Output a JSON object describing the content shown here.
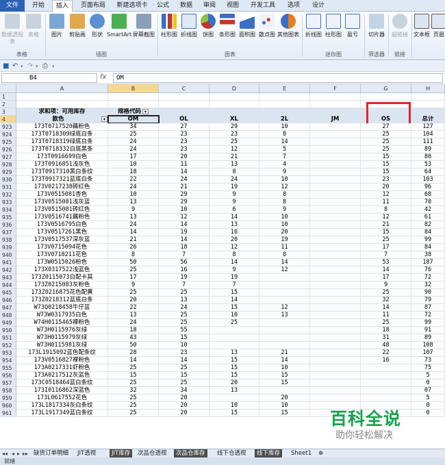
{
  "ribbon": {
    "tabs": [
      "文件",
      "开始",
      "插入",
      "页面布局",
      "新建选项卡",
      "公式",
      "数据",
      "审阅",
      "视图",
      "开发工具",
      "选项",
      "设计"
    ],
    "active_tab": "插入",
    "buttons": [
      "数据透视表",
      "表格",
      "图片",
      "剪贴画",
      "形状",
      "SmartArt",
      "屏幕截图",
      "柱形图",
      "折线图",
      "饼图",
      "条形图",
      "面积图",
      "散点图",
      "其他图表",
      "折线图",
      "柱形图",
      "盈亏",
      "切片器",
      "超链接",
      "文本框",
      "页眉"
    ],
    "groups": [
      "表格",
      "插图",
      "图表",
      "迷你图",
      "筛选器",
      "链接"
    ]
  },
  "formula_bar": {
    "name_box": "B4",
    "fx": "fx",
    "content": "OM"
  },
  "columns": [
    "A",
    "B",
    "C",
    "D",
    "E",
    "F",
    "G",
    "H"
  ],
  "header_rows": {
    "r1": "1",
    "r2": "2",
    "r3": "3",
    "r4": "4",
    "pivot_title": "求和项：可用库存",
    "size_code": "规格代码",
    "style_color": "款色",
    "sizes": [
      "OM",
      "OL",
      "XL",
      "2L",
      "JM",
      "OS",
      "总计"
    ]
  },
  "rows": [
    {
      "n": "923",
      "name": "173T0717520藕粉色",
      "v": [
        "34",
        "27",
        "29",
        "10",
        "",
        "27",
        "127"
      ]
    },
    {
      "n": "924",
      "name": "173T0718309绿底白条",
      "v": [
        "25",
        "23",
        "23",
        "8",
        "",
        "25",
        "104"
      ]
    },
    {
      "n": "925",
      "name": "173T0718319绿底白条",
      "v": [
        "24",
        "23",
        "25",
        "14",
        "",
        "25",
        "111"
      ]
    },
    {
      "n": "926",
      "name": "173T0718332白底黑条",
      "v": [
        "24",
        "23",
        "12",
        "5",
        "",
        "25",
        "89"
      ]
    },
    {
      "n": "927",
      "name": "173T0916699白色",
      "v": [
        "17",
        "20",
        "21",
        "7",
        "",
        "15",
        "80"
      ]
    },
    {
      "n": "928",
      "name": "173T0916851浅灰色",
      "v": [
        "10",
        "11",
        "13",
        "4",
        "",
        "15",
        "53"
      ]
    },
    {
      "n": "929",
      "name": "173T0917310黑白条纹",
      "v": [
        "18",
        "14",
        "8",
        "9",
        "",
        "15",
        "64"
      ]
    },
    {
      "n": "930",
      "name": "173T0917321蓝底白条",
      "v": [
        "22",
        "24",
        "24",
        "10",
        "",
        "23",
        "103"
      ]
    },
    {
      "n": "931",
      "name": "173V0217238砖红色",
      "v": [
        "24",
        "21",
        "19",
        "12",
        "",
        "20",
        "96"
      ]
    },
    {
      "n": "932",
      "name": "173V0515081杏色",
      "v": [
        "10",
        "29",
        "9",
        "8",
        "",
        "12",
        "68"
      ]
    },
    {
      "n": "933",
      "name": "173V0515081浅灰蓝",
      "v": [
        "13",
        "29",
        "9",
        "8",
        "",
        "11",
        "70"
      ]
    },
    {
      "n": "934",
      "name": "173V0515081砖红色",
      "v": [
        "9",
        "10",
        "6",
        "9",
        "",
        "8",
        "42"
      ]
    },
    {
      "n": "935",
      "name": "173V0516741藕粉色",
      "v": [
        "13",
        "12",
        "14",
        "10",
        "",
        "12",
        "61"
      ]
    },
    {
      "n": "936",
      "name": "173V0516795白色",
      "v": [
        "24",
        "14",
        "13",
        "10",
        "",
        "21",
        "82"
      ]
    },
    {
      "n": "937",
      "name": "173V0517261黑色",
      "v": [
        "14",
        "19",
        "16",
        "20",
        "",
        "15",
        "84"
      ]
    },
    {
      "n": "938",
      "name": "173V0517537深灰蓝",
      "v": [
        "21",
        "14",
        "20",
        "19",
        "",
        "25",
        "99"
      ]
    },
    {
      "n": "939",
      "name": "173V0715094花色",
      "v": [
        "26",
        "18",
        "12",
        "11",
        "",
        "17",
        "84"
      ]
    },
    {
      "n": "940",
      "name": "173V0718211花色",
      "v": [
        "8",
        "7",
        "8",
        "8",
        "",
        "7",
        "38"
      ]
    },
    {
      "n": "941",
      "name": "173W0515026粉色",
      "v": [
        "50",
        "56",
        "14",
        "14",
        "",
        "53",
        "187"
      ]
    },
    {
      "n": "942",
      "name": "173X0317522浅蓝色",
      "v": [
        "25",
        "16",
        "9",
        "12",
        "",
        "14",
        "76"
      ]
    },
    {
      "n": "943",
      "name": "173Z0115073白配卡其",
      "v": [
        "17",
        "19",
        "19",
        "",
        "",
        "17",
        "72"
      ]
    },
    {
      "n": "944",
      "name": "173Z0215083灰粉色",
      "v": [
        "9",
        "7",
        "7",
        "",
        "",
        "9",
        "32"
      ]
    },
    {
      "n": "945",
      "name": "173Z0216875花色配黄",
      "v": [
        "25",
        "25",
        "15",
        "",
        "",
        "25",
        "90"
      ]
    },
    {
      "n": "946",
      "name": "173Z0218312蓝底白条",
      "v": [
        "20",
        "13",
        "14",
        "",
        "",
        "32",
        "79"
      ]
    },
    {
      "n": "947",
      "name": "W73Q0218458牛仔蓝",
      "v": [
        "22",
        "24",
        "15",
        "12",
        "",
        "14",
        "87"
      ]
    },
    {
      "n": "948",
      "name": "W73W0317935白色",
      "v": [
        "13",
        "25",
        "10",
        "13",
        "",
        "11",
        "72"
      ]
    },
    {
      "n": "949",
      "name": "W74H0115465裸粉色",
      "v": [
        "24",
        "25",
        "25",
        "",
        "",
        "25",
        "99"
      ]
    },
    {
      "n": "950",
      "name": "W73H0115976灰绿",
      "v": [
        "18",
        "55",
        "",
        "",
        "",
        "18",
        "91"
      ]
    },
    {
      "n": "951",
      "name": "W73H0115979灰绿",
      "v": [
        "43",
        "15",
        "",
        "",
        "",
        "31",
        "89"
      ]
    },
    {
      "n": "952",
      "name": "W73H0115981灰绿",
      "v": [
        "50",
        "10",
        "",
        "",
        "",
        "48",
        "108"
      ]
    },
    {
      "n": "953",
      "name": "173L1915092蓝色配条纹",
      "v": [
        "28",
        "23",
        "13",
        "21",
        "",
        "22",
        "107"
      ]
    },
    {
      "n": "954",
      "name": "173V0516827裸粉色",
      "v": [
        "14",
        "14",
        "15",
        "14",
        "",
        "16",
        "73"
      ]
    },
    {
      "n": "955",
      "name": "173A0217331虾粉色",
      "v": [
        "25",
        "25",
        "15",
        "10",
        "",
        "",
        "75"
      ]
    },
    {
      "n": "956",
      "name": "173A0217512灰蓝色",
      "v": [
        "15",
        "15",
        "15",
        "15",
        "",
        "",
        "5"
      ]
    },
    {
      "n": "957",
      "name": "173C0518464蓝白条纹",
      "v": [
        "25",
        "25",
        "20",
        "15",
        "",
        "",
        "0"
      ]
    },
    {
      "n": "958",
      "name": "173I0116862深蓝色",
      "v": [
        "32",
        "34",
        "13",
        "",
        "",
        "",
        "07"
      ]
    },
    {
      "n": "959",
      "name": "173L0617552花色",
      "v": [
        "25",
        "20",
        "",
        "20",
        "",
        "",
        "5"
      ]
    },
    {
      "n": "960",
      "name": "173L1817334灰白条纹",
      "v": [
        "25",
        "20",
        "10",
        "10",
        "",
        "",
        "0"
      ]
    },
    {
      "n": "961",
      "name": "173L1917349蓝白条纹",
      "v": [
        "25",
        "20",
        "15",
        "15",
        "",
        "",
        "0"
      ]
    }
  ],
  "sheet_tabs": [
    "缺货订单明细",
    "JIT透视",
    "JIT库存",
    "次品仓透视",
    "次品仓库存",
    "线下仓透视",
    "线下库存",
    "Sheet1"
  ],
  "status": "就绪",
  "watermark": {
    "title": "百科全说",
    "subtitle": "助你轻松解决"
  }
}
